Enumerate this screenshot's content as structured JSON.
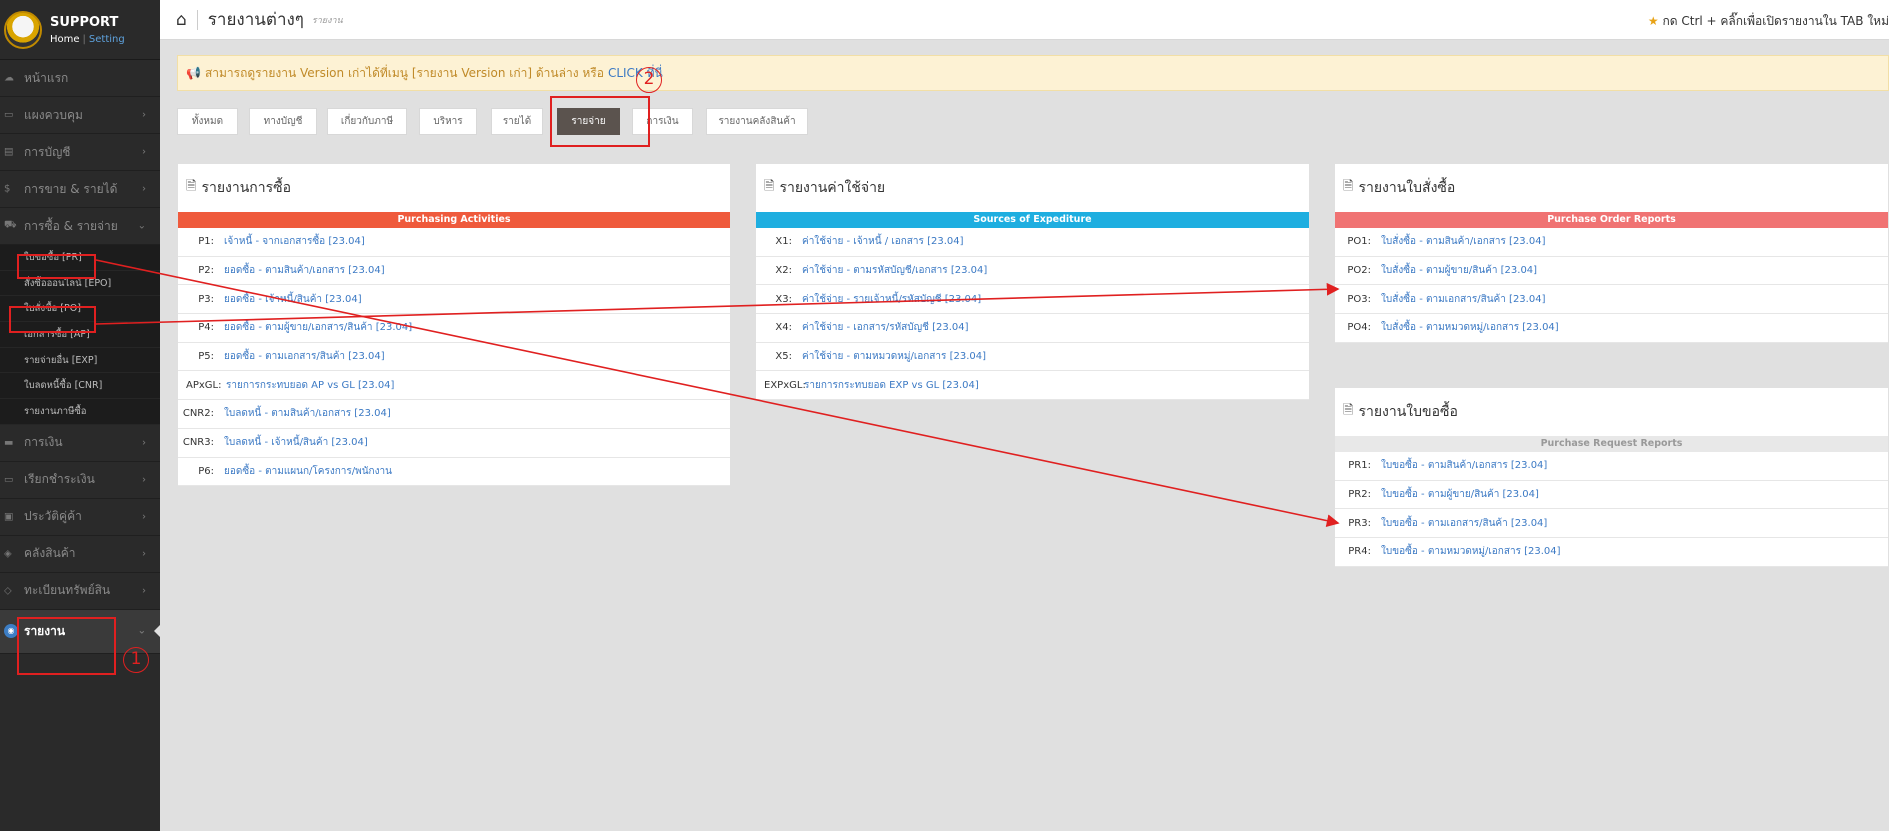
{
  "brand": {
    "name": "SUPPORT",
    "home": "Home",
    "separator": "|",
    "setting": "Setting"
  },
  "sidebar": {
    "items_top": [
      {
        "label": "หน้าแรก",
        "icon": "cloud-icon",
        "glyph": "☁",
        "chevron": ""
      },
      {
        "label": "แผงควบคุม",
        "icon": "monitor-icon",
        "glyph": "▭",
        "chevron": "›"
      },
      {
        "label": "การบัญชี",
        "icon": "book-icon",
        "glyph": "▤",
        "chevron": "›"
      },
      {
        "label": "การขาย & รายได้",
        "icon": "dollar-icon",
        "glyph": "$",
        "chevron": "›"
      },
      {
        "label": "การซื้อ & รายจ่าย",
        "icon": "cart-icon",
        "glyph": "⛟",
        "chevron": "⌄"
      }
    ],
    "submenu": [
      "ใบขอซื้อ [PR]",
      "สั่งซื้อออนไลน์ [EPO]",
      "ใบสั่งซื้อ [PO]",
      "เอกสารซื้อ [AP]",
      "รายจ่ายอื่น [EXP]",
      "ใบลดหนี้ซื้อ [CNR]",
      "รายงานภาษีซื้อ"
    ],
    "items_bottom": [
      {
        "label": "การเงิน",
        "icon": "money-icon",
        "glyph": "▬",
        "chevron": "›"
      },
      {
        "label": "เรียกชำระเงิน",
        "icon": "card-icon",
        "glyph": "▭",
        "chevron": "›"
      },
      {
        "label": "ประวัติคู่ค้า",
        "icon": "contact-icon",
        "glyph": "▣",
        "chevron": "›"
      },
      {
        "label": "คลังสินค้า",
        "icon": "cubes-icon",
        "glyph": "◈",
        "chevron": "›"
      },
      {
        "label": "ทะเบียนทรัพย์สิน",
        "icon": "diamond-icon",
        "glyph": "◇",
        "chevron": "›"
      }
    ],
    "active": {
      "label": "รายงาน",
      "icon": "report-icon",
      "glyph": "◉",
      "chevron": "⌄"
    }
  },
  "header": {
    "title": "รายงานต่างๆ",
    "subtitle": "รายงาน",
    "hint": "กด Ctrl + คลิ๊กเพื่อเปิดรายงานใน TAB ใหม่",
    "star": "★",
    "home_glyph": "⌂"
  },
  "alert": {
    "horn": "📢",
    "text": "สามารถดูรายงาน Version เก่าได้ที่เมนู [รายงาน Version เก่า] ด้านล่าง หรือ",
    "click": "CLICK ที่นี่"
  },
  "tabs": [
    "ทั้งหมด",
    "ทางบัญชี",
    "เกี่ยวกับภาษี",
    "บริหาร",
    "รายได้",
    "รายจ่าย",
    "การเงิน",
    "รายงานคลังสินค้า"
  ],
  "panels": {
    "purchase": {
      "title": "รายงานการซื้อ",
      "band": "Purchasing Activities",
      "band_color": "#ef5a3c",
      "rows": [
        {
          "code": "P1:",
          "text": "เจ้าหนี้ - จากเอกสารซื้อ [23.04]"
        },
        {
          "code": "P2:",
          "text": "ยอดซื้อ - ตามสินค้า/เอกสาร [23.04]"
        },
        {
          "code": "P3:",
          "text": "ยอดซื้อ - เจ้าหนี้/สินค้า [23.04]"
        },
        {
          "code": "P4:",
          "text": "ยอดซื้อ - ตามผู้ขาย/เอกสาร/สินค้า [23.04]"
        },
        {
          "code": "P5:",
          "text": "ยอดซื้อ - ตามเอกสาร/สินค้า [23.04]"
        },
        {
          "code": "APxGL:",
          "text": "รายการกระทบยอด AP vs GL [23.04]"
        },
        {
          "code": "CNR2:",
          "text": "ใบลดหนี้ - ตามสินค้า/เอกสาร [23.04]"
        },
        {
          "code": "CNR3:",
          "text": "ใบลดหนี้ - เจ้าหนี้/สินค้า [23.04]"
        },
        {
          "code": "P6:",
          "text": "ยอดซื้อ - ตามแผนก/โครงการ/พนักงาน"
        }
      ]
    },
    "expense": {
      "title": "รายงานค่าใช้จ่าย",
      "band": "Sources of Expediture",
      "band_color": "#1eaee0",
      "rows": [
        {
          "code": "X1:",
          "text": "ค่าใช้จ่าย - เจ้าหนี้ / เอกสาร [23.04]"
        },
        {
          "code": "X2:",
          "text": "ค่าใช้จ่าย - ตามรหัสบัญชี/เอกสาร [23.04]"
        },
        {
          "code": "X3:",
          "text": "ค่าใช้จ่าย - รายเจ้าหนี้/รหัสบัญชี [23.04]"
        },
        {
          "code": "X4:",
          "text": "ค่าใช้จ่าย - เอกสาร/รหัสบัญชี [23.04]"
        },
        {
          "code": "X5:",
          "text": "ค่าใช้จ่าย - ตามหมวดหมู่/เอกสาร [23.04]"
        },
        {
          "code": "EXPxGL:",
          "text": "รายการกระทบยอด EXP vs GL [23.04]"
        }
      ]
    },
    "po": {
      "title": "รายงานใบสั่งซื้อ",
      "band": "Purchase Order Reports",
      "band_color": "#f07373",
      "rows": [
        {
          "code": "PO1:",
          "text": "ใบสั่งซื้อ - ตามสินค้า/เอกสาร [23.04]"
        },
        {
          "code": "PO2:",
          "text": "ใบสั่งซื้อ - ตามผู้ขาย/สินค้า [23.04]"
        },
        {
          "code": "PO3:",
          "text": "ใบสั่งซื้อ - ตามเอกสาร/สินค้า [23.04]"
        },
        {
          "code": "PO4:",
          "text": "ใบสั่งซื้อ - ตามหมวดหมู่/เอกสาร [23.04]"
        }
      ]
    },
    "pr": {
      "title": "รายงานใบขอซื้อ",
      "band": "Purchase Request Reports",
      "band_color": "#e8e8e8",
      "rows": [
        {
          "code": "PR1:",
          "text": "ใบขอซื้อ - ตามสินค้า/เอกสาร [23.04]"
        },
        {
          "code": "PR2:",
          "text": "ใบขอซื้อ - ตามผู้ขาย/สินค้า [23.04]"
        },
        {
          "code": "PR3:",
          "text": "ใบขอซื้อ - ตามเอกสาร/สินค้า [23.04]"
        },
        {
          "code": "PR4:",
          "text": "ใบขอซื้อ - ตามหมวดหมู่/เอกสาร [23.04]"
        }
      ]
    }
  },
  "annotations": {
    "one": "1",
    "two": "2"
  },
  "doc_glyph": "🗎"
}
